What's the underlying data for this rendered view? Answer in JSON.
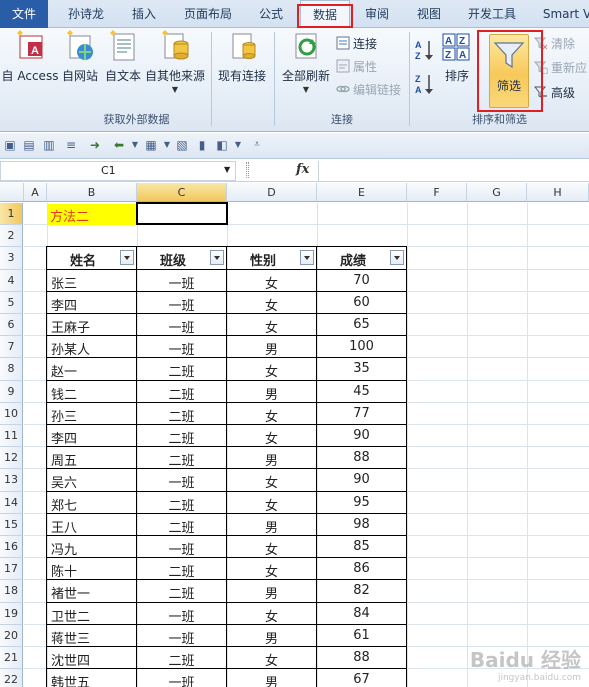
{
  "tabs": [
    "文件",
    "孙诗龙",
    "插入",
    "页面布局",
    "公式",
    "数据",
    "审阅",
    "视图",
    "开发工具",
    "Smart V"
  ],
  "ribbon": {
    "external": {
      "access": "自 Access",
      "web": "自网站",
      "text": "自文本",
      "other": "自其他来源",
      "existing": "现有连接",
      "group_label": "获取外部数据"
    },
    "connections": {
      "refresh_all": "全部刷新",
      "connections": "连接",
      "properties": "属性",
      "edit_links": "编辑链接",
      "group_label": "连接"
    },
    "sort_filter": {
      "sort": "排序",
      "filter": "筛选",
      "clear": "清除",
      "reapply": "重新应",
      "advanced": "高级",
      "group_label": "排序和筛选"
    }
  },
  "name_box": "C1",
  "fx_label": "fx",
  "columns": [
    "A",
    "B",
    "C",
    "D",
    "E",
    "F",
    "G",
    "H"
  ],
  "rows": [
    "1",
    "2",
    "3",
    "4",
    "5",
    "6",
    "7",
    "8",
    "9",
    "10",
    "11",
    "12",
    "13",
    "14",
    "15",
    "16",
    "17",
    "18",
    "19",
    "20",
    "21",
    "22"
  ],
  "b1_text": "方法二",
  "table": {
    "headers": [
      "姓名",
      "班级",
      "性别",
      "成绩"
    ],
    "rows": [
      [
        "张三",
        "一班",
        "女",
        "70"
      ],
      [
        "李四",
        "一班",
        "女",
        "60"
      ],
      [
        "王麻子",
        "一班",
        "女",
        "65"
      ],
      [
        "孙某人",
        "一班",
        "男",
        "100"
      ],
      [
        "赵一",
        "二班",
        "女",
        "35"
      ],
      [
        "钱二",
        "二班",
        "男",
        "45"
      ],
      [
        "孙三",
        "二班",
        "女",
        "77"
      ],
      [
        "李四",
        "二班",
        "女",
        "90"
      ],
      [
        "周五",
        "二班",
        "男",
        "88"
      ],
      [
        "吴六",
        "一班",
        "女",
        "90"
      ],
      [
        "郑七",
        "二班",
        "女",
        "95"
      ],
      [
        "王八",
        "二班",
        "男",
        "98"
      ],
      [
        "冯九",
        "一班",
        "女",
        "85"
      ],
      [
        "陈十",
        "二班",
        "女",
        "86"
      ],
      [
        "褚世一",
        "二班",
        "男",
        "82"
      ],
      [
        "卫世二",
        "一班",
        "女",
        "84"
      ],
      [
        "蒋世三",
        "一班",
        "男",
        "61"
      ],
      [
        "沈世四",
        "二班",
        "女",
        "88"
      ],
      [
        "韩世五",
        "一班",
        "男",
        "67"
      ]
    ]
  },
  "watermark": {
    "main": "Baidu 经验",
    "sub": "jingyan.baidu.com"
  }
}
